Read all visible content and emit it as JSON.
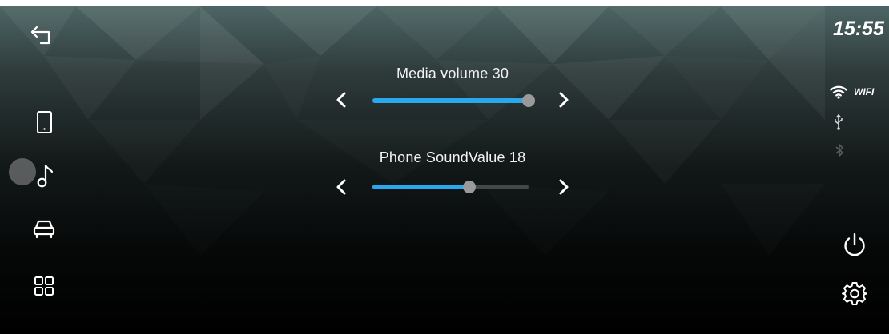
{
  "status": {
    "time": "15:55",
    "wifi_label": "WIFI",
    "icons": [
      "wifi-icon",
      "usb-icon",
      "bluetooth-icon"
    ]
  },
  "nav": {
    "back": "back-icon",
    "items": [
      "phone-icon",
      "music-icon",
      "car-icon",
      "apps-icon"
    ],
    "active_item": "music-icon"
  },
  "volume": {
    "media": {
      "label": "Media volume 30",
      "level_fraction": 1.0
    },
    "phone": {
      "label": "Phone SoundValue 18",
      "level_fraction": 0.62
    }
  },
  "actions": [
    "power-icon",
    "settings-icon"
  ],
  "colors": {
    "accent": "#2aa8ee",
    "thumb": "#9a9a9a",
    "track": "#454849",
    "text": "#ffffff"
  }
}
